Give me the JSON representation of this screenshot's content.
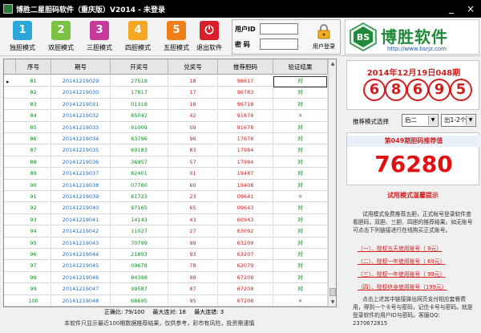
{
  "window": {
    "title": "博胜二星胆码软件（重庆版）V2014 - 未登录",
    "minimize_glyph": "_",
    "close_glyph": "×"
  },
  "toolbar": {
    "modes": [
      {
        "num": "1",
        "label": "独胆模式",
        "color": "#2aa6d8"
      },
      {
        "num": "2",
        "label": "双胆模式",
        "color": "#7cc243"
      },
      {
        "num": "3",
        "label": "三胆模式",
        "color": "#c7399b"
      },
      {
        "num": "4",
        "label": "四胆模式",
        "color": "#f5a623"
      },
      {
        "num": "5",
        "label": "五胆模式",
        "color": "#f07f1a"
      }
    ],
    "exit_label": "退出软件",
    "exit_color": "#d8202a"
  },
  "login": {
    "id_label": "用户ID",
    "pwd_label": "密  码",
    "id_value": "",
    "pwd_value": "",
    "login_button": "用户登录"
  },
  "brand": {
    "logo_text": "BS",
    "name": "博胜软件",
    "url": "http://www.bsrjz.com"
  },
  "table": {
    "columns": [
      "序号",
      "期号",
      "开奖号",
      "兑奖号",
      "推荐胆码",
      "验证结果"
    ],
    "rows": [
      [
        "81",
        "20141219029",
        "27518",
        "18",
        "98617",
        "对"
      ],
      [
        "82",
        "20141219030",
        "17817",
        "17",
        "96783",
        "对"
      ],
      [
        "83",
        "20141219031",
        "01318",
        "18",
        "96718",
        "对"
      ],
      [
        "84",
        "20141219032",
        "85042",
        "42",
        "91678",
        "×"
      ],
      [
        "85",
        "20141219033",
        "91009",
        "09",
        "91678",
        "对"
      ],
      [
        "86",
        "20141219034",
        "83796",
        "96",
        "17678",
        "对"
      ],
      [
        "87",
        "20141219035",
        "69183",
        "83",
        "17984",
        "对"
      ],
      [
        "88",
        "20141219036",
        "36957",
        "57",
        "17984",
        "对"
      ],
      [
        "89",
        "20141219037",
        "82401",
        "01",
        "19487",
        "对"
      ],
      [
        "90",
        "20141219038",
        "07760",
        "60",
        "19408",
        "对"
      ],
      [
        "91",
        "20141219039",
        "81723",
        "23",
        "09641",
        "×"
      ],
      [
        "92",
        "20141219040",
        "97165",
        "65",
        "09643",
        "对"
      ],
      [
        "93",
        "20141219041",
        "14143",
        "43",
        "60943",
        "对"
      ],
      [
        "94",
        "20141219042",
        "11027",
        "27",
        "63092",
        "对"
      ],
      [
        "95",
        "20141219043",
        "70799",
        "99",
        "63209",
        "对"
      ],
      [
        "96",
        "20141219044",
        "21893",
        "93",
        "63207",
        "对"
      ],
      [
        "97",
        "20141219045",
        "09678",
        "78",
        "62079",
        "对"
      ],
      [
        "98",
        "20141219046",
        "84398",
        "98",
        "67208",
        "对"
      ],
      [
        "99",
        "20141219047",
        "99587",
        "87",
        "67208",
        "对"
      ],
      [
        "100",
        "20141219048",
        "68695",
        "95",
        "67208",
        "×"
      ]
    ]
  },
  "stats": {
    "accuracy": "正确比: 79/100",
    "max_hit": "最大连对: 18",
    "max_miss": "最大连错: 3"
  },
  "footer_note": "本软件只显示最近100期数据推荐结果，仅供参考，彩市有风险，投资需谨慎",
  "draw": {
    "date": "2014年12月19日048期",
    "balls": [
      "6",
      "8",
      "6",
      "9",
      "5"
    ]
  },
  "recommend_mode": {
    "label": "推荐模式选择",
    "mode_value": "后二",
    "count_value": "出1-2个"
  },
  "recommend": {
    "title": "第049期胆码推荐值",
    "value": "76280"
  },
  "trial": {
    "title": "试用模式温馨提示",
    "body": "试用模式免费推荐五胆，正式帐号登录软件查看胆码，双胆、三胆、四胆的推荐结果。如无账号可点击下列链接进行在线购买正式账号。",
    "links": [
      "（一）、授权五天使用账号（  9元）",
      "（二）、授权一年使用账号（ 69元）",
      "（三）、授权一年使用账号（ 99元）",
      "（四）、授权终身使用账号（199元）"
    ],
    "contact": "点击上述其中链接弹出网页支付相应套餐费用，得到一个卡号与密码，记住卡号与密码，就是登录软件的用户ID与密码。客服QQ: 2370672815"
  }
}
